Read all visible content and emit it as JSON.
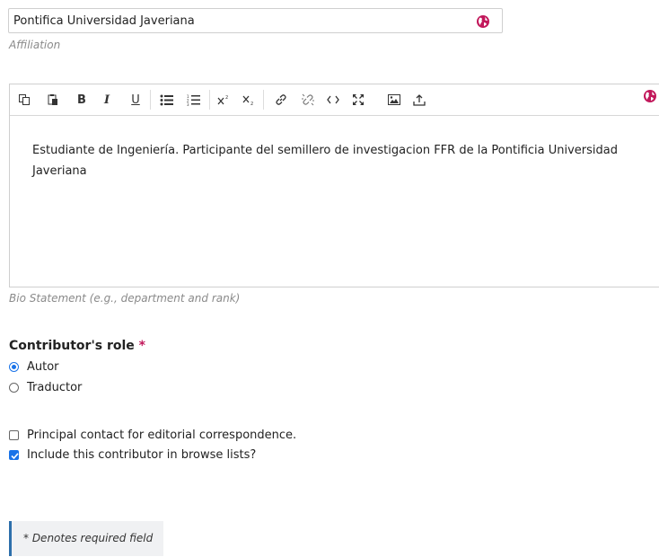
{
  "affiliation": {
    "value": "Pontifica Universidad Javeriana",
    "label": "Affiliation",
    "globe_icon": "globe-icon"
  },
  "editor": {
    "toolbar": [
      {
        "name": "copy-icon"
      },
      {
        "name": "paste-icon"
      },
      {
        "name": "bold-icon",
        "glyph": "B"
      },
      {
        "name": "italic-icon",
        "glyph": "I"
      },
      {
        "name": "underline-icon",
        "glyph": "U"
      },
      {
        "name": "bullet-list-icon"
      },
      {
        "name": "numbered-list-icon"
      },
      {
        "name": "superscript-icon"
      },
      {
        "name": "subscript-icon"
      },
      {
        "name": "link-icon"
      },
      {
        "name": "unlink-icon"
      },
      {
        "name": "code-icon"
      },
      {
        "name": "fullscreen-icon"
      },
      {
        "name": "image-icon"
      },
      {
        "name": "upload-icon"
      }
    ],
    "content": "Estudiante de Ingeniería. Participante del semillero de investigacion FFR de la Pontificia Universidad Javeriana",
    "label": "Bio Statement (e.g., department and rank)"
  },
  "role": {
    "title": "Contributor's role",
    "required_mark": "*",
    "options": [
      {
        "label": "Autor",
        "checked": true
      },
      {
        "label": "Traductor",
        "checked": false
      }
    ]
  },
  "checkboxes": [
    {
      "label": "Principal contact for editorial correspondence.",
      "checked": false
    },
    {
      "label": "Include this contributor in browse lists?",
      "checked": true
    }
  ],
  "note": "* Denotes required field",
  "colors": {
    "accent": "#1a73e8",
    "globe": "#c2185b",
    "note_border": "#2d6fab"
  }
}
